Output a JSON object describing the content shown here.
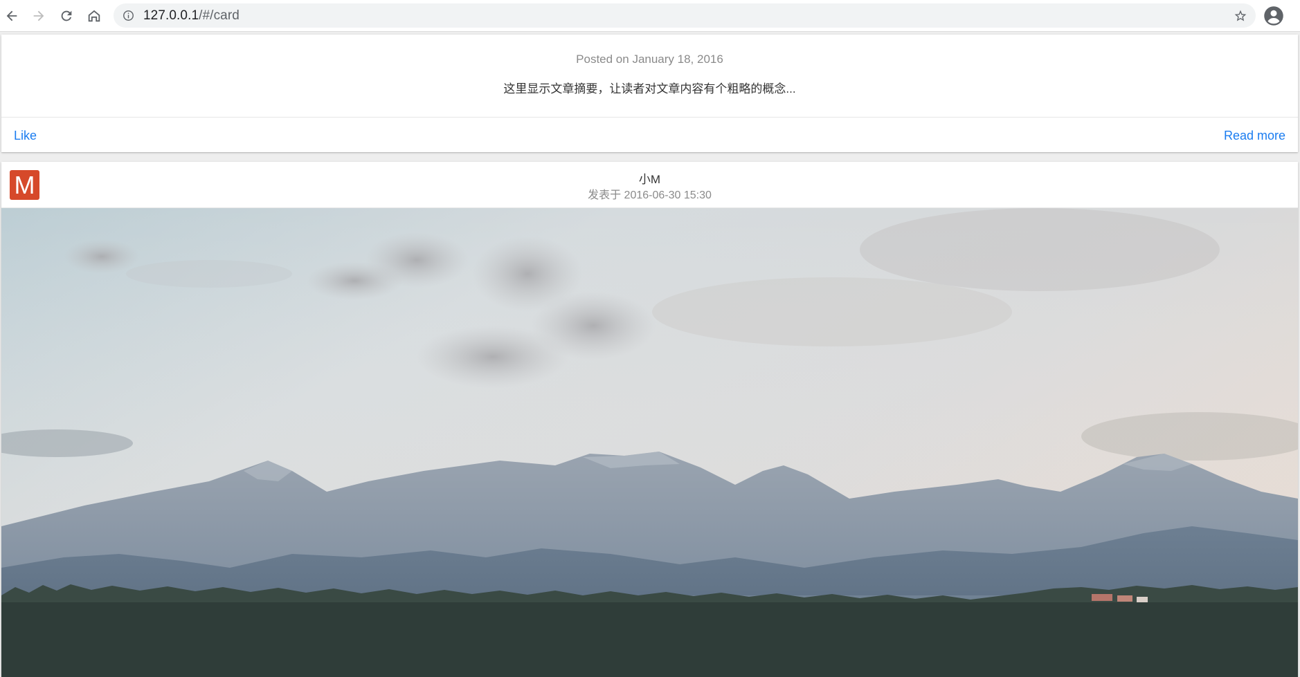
{
  "browser": {
    "url_host": "127.0.0.1",
    "url_path": "/#/card"
  },
  "card1": {
    "subtitle": "Posted on January 18, 2016",
    "summary": "这里显示文章摘要，让读者对文章内容有个粗略的概念...",
    "like_label": "Like",
    "read_more_label": "Read more",
    "link_color": "#1a7cf0"
  },
  "card2": {
    "avatar_letter": "M",
    "avatar_color": "#d6492a",
    "author": "小M",
    "posted_time": "发表于 2016-06-30 15:30",
    "image_subject": "mountain-landscape-photo"
  }
}
